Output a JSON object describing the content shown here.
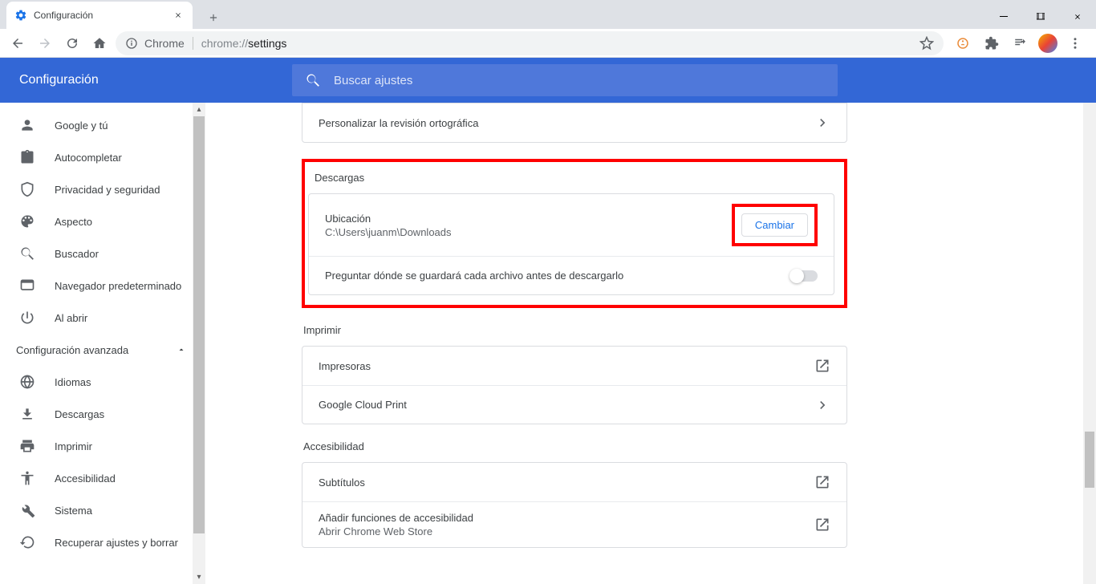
{
  "browser": {
    "tab_title": "Configuración",
    "url_prefix": "Chrome",
    "url_lead": "chrome://",
    "url_path": "settings"
  },
  "header": {
    "title": "Configuración",
    "search_placeholder": "Buscar ajustes"
  },
  "sidebar": {
    "items": [
      {
        "label": "Google y tú"
      },
      {
        "label": "Autocompletar"
      },
      {
        "label": "Privacidad y seguridad"
      },
      {
        "label": "Aspecto"
      },
      {
        "label": "Buscador"
      },
      {
        "label": "Navegador predeterminado"
      },
      {
        "label": "Al abrir"
      }
    ],
    "advanced_label": "Configuración avanzada",
    "advanced_items": [
      {
        "label": "Idiomas"
      },
      {
        "label": "Descargas"
      },
      {
        "label": "Imprimir"
      },
      {
        "label": "Accesibilidad"
      },
      {
        "label": "Sistema"
      },
      {
        "label": "Recuperar ajustes y borrar"
      }
    ]
  },
  "content": {
    "spellcheck_row": "Personalizar la revisión ortográfica",
    "downloads": {
      "title": "Descargas",
      "location_label": "Ubicación",
      "location_path": "C:\\Users\\juanm\\Downloads",
      "change_btn": "Cambiar",
      "ask_label": "Preguntar dónde se guardará cada archivo antes de descargarlo"
    },
    "print": {
      "title": "Imprimir",
      "printers": "Impresoras",
      "gcp": "Google Cloud Print"
    },
    "a11y": {
      "title": "Accesibilidad",
      "subtitles": "Subtítulos",
      "add_features": "Añadir funciones de accesibilidad",
      "webstore": "Abrir Chrome Web Store"
    }
  }
}
